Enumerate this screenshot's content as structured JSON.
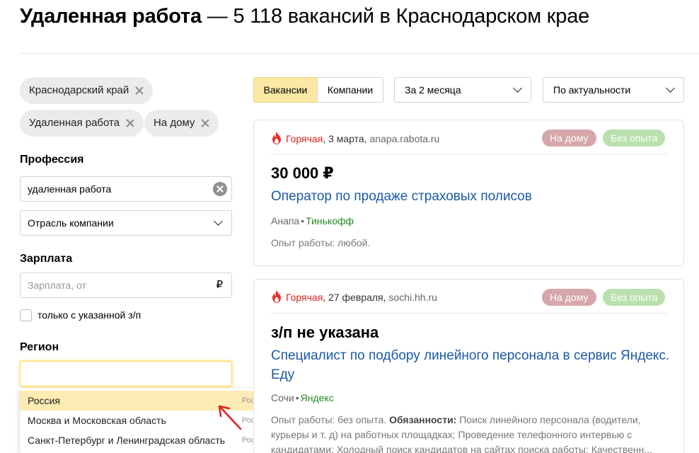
{
  "header": {
    "title_bold": "Удаленная работа",
    "title_rest": " — 5 118 вакансий в Краснодарском крае"
  },
  "filters": {
    "chips": [
      {
        "label": "Краснодарский край"
      },
      {
        "label": "Удаленная работа"
      },
      {
        "label": "На дому"
      }
    ],
    "profession": {
      "label": "Профессия",
      "value": "удаленная работа",
      "industry_select": "Отрасль компании"
    },
    "salary": {
      "label": "Зарплата",
      "placeholder": "Зарплата, от",
      "currency": "₽",
      "only_with_salary": "только с указанной з/п"
    },
    "region": {
      "label": "Регион",
      "value": "",
      "suggestions": [
        {
          "name": "Россия",
          "country": "Россия"
        },
        {
          "name": "Москва и Московская область",
          "country": "Россия"
        },
        {
          "name": "Санкт-Петербург и Ленинградская область",
          "country": "Россия"
        }
      ]
    }
  },
  "toolbar": {
    "tab_vacancies": "Вакансии",
    "tab_companies": "Компании",
    "period": "За 2 месяца",
    "sort": "По актуальности"
  },
  "vacancies": [
    {
      "hot": "Горячая",
      "date": "3 марта,",
      "source": "anapa.rabota.ru",
      "tags": [
        "На дому",
        "Без опыта"
      ],
      "salary": "30 000 ₽",
      "title": "Оператор по продаже страховых полисов",
      "city": "Анапа",
      "company": "Тинькофф",
      "experience": "Опыт работы: любой."
    },
    {
      "hot": "Горячая",
      "date": "27 февраля,",
      "source": "sochi.hh.ru",
      "tags": [
        "На дому",
        "Без опыта"
      ],
      "salary": "з/п не указана",
      "title": "Специалист по подбору линейного персонала в сервис Яндекс. Еду",
      "city": "Сочи",
      "company": "Яндекс",
      "experience": "Опыт работы: без опыта.",
      "duties_label": "Обязанности:",
      "duties": " Поиск линейного персонала (водители, курьеры и т. д) на работных площадках; Проведение телефонного интервью с кандидатами; Холодный поиск кандидатов на сайтах поиска работы; Качественн..."
    }
  ]
}
